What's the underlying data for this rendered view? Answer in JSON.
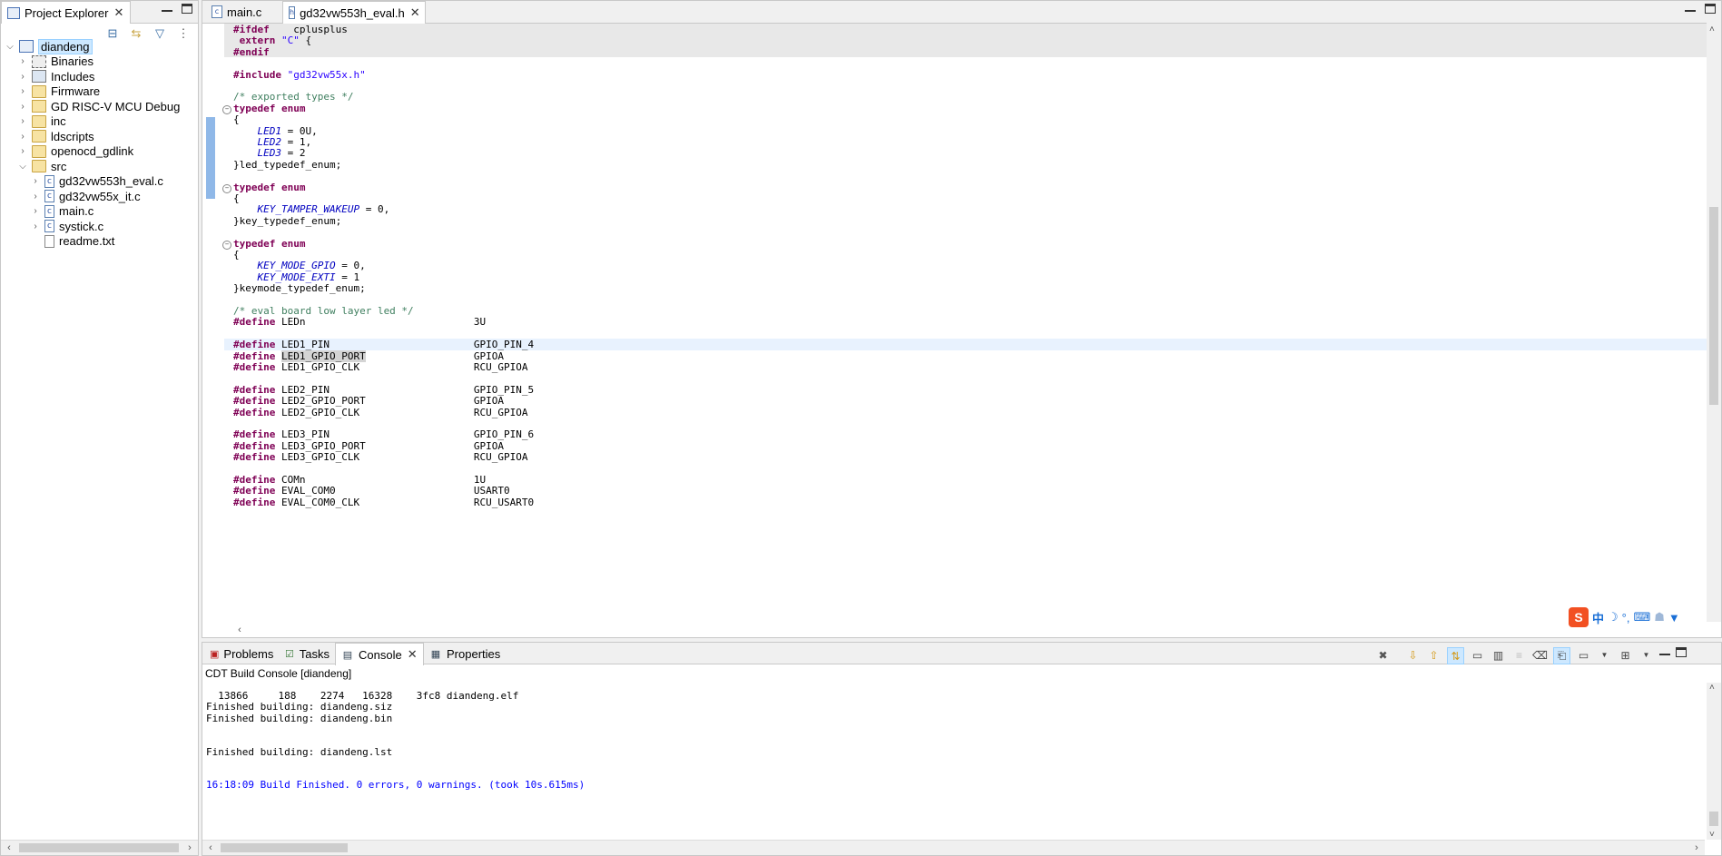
{
  "project_explorer": {
    "tab_label": "Project Explorer",
    "tree": [
      {
        "label": "diandeng",
        "type": "project",
        "expanded": true,
        "depth": 0,
        "selected": true
      },
      {
        "label": "Binaries",
        "type": "binaries",
        "depth": 1
      },
      {
        "label": "Includes",
        "type": "includes",
        "depth": 1
      },
      {
        "label": "Firmware",
        "type": "folder",
        "depth": 1
      },
      {
        "label": "GD RISC-V MCU Debug",
        "type": "debug",
        "depth": 1
      },
      {
        "label": "inc",
        "type": "folder",
        "depth": 1
      },
      {
        "label": "ldscripts",
        "type": "folder",
        "depth": 1
      },
      {
        "label": "openocd_gdlink",
        "type": "folder",
        "depth": 1
      },
      {
        "label": "src",
        "type": "folder",
        "expanded": true,
        "depth": 1
      },
      {
        "label": "gd32vw553h_eval.c",
        "type": "cfile",
        "depth": 2
      },
      {
        "label": "gd32vw55x_it.c",
        "type": "cfile",
        "depth": 2
      },
      {
        "label": "main.c",
        "type": "cfile",
        "depth": 2
      },
      {
        "label": "systick.c",
        "type": "cfile",
        "depth": 2
      },
      {
        "label": "readme.txt",
        "type": "txt",
        "depth": 2,
        "no_arrow": true
      }
    ]
  },
  "editor": {
    "tabs": [
      {
        "label": "main.c",
        "active": false
      },
      {
        "label": "gd32vw553h_eval.h",
        "active": true
      }
    ],
    "code_lines": [
      {
        "segs": [
          [
            "pp",
            "#ifdef"
          ],
          [
            "",
            "  __cplusplus"
          ]
        ],
        "shade": true
      },
      {
        "segs": [
          [
            "kw",
            " extern"
          ],
          [
            "",
            " "
          ],
          [
            "str",
            "\"C\""
          ],
          [
            "",
            " {"
          ]
        ],
        "shade": true
      },
      {
        "segs": [
          [
            "pp",
            "#endif"
          ]
        ],
        "shade": true
      },
      {
        "segs": []
      },
      {
        "segs": [
          [
            "pp",
            "#include"
          ],
          [
            "",
            " "
          ],
          [
            "str",
            "\"gd32vw55x.h\""
          ]
        ]
      },
      {
        "segs": []
      },
      {
        "segs": [
          [
            "cm",
            "/* exported types */"
          ]
        ]
      },
      {
        "segs": [
          [
            "kw",
            "typedef"
          ],
          [
            "",
            " "
          ],
          [
            "kw",
            "enum"
          ]
        ],
        "fold": true
      },
      {
        "segs": [
          [
            "",
            "{"
          ]
        ]
      },
      {
        "segs": [
          [
            "",
            "    "
          ],
          [
            "en",
            "LED1"
          ],
          [
            "",
            " = 0U,"
          ]
        ]
      },
      {
        "segs": [
          [
            "",
            "    "
          ],
          [
            "en",
            "LED2"
          ],
          [
            "",
            " = 1,"
          ]
        ]
      },
      {
        "segs": [
          [
            "",
            "    "
          ],
          [
            "en",
            "LED3"
          ],
          [
            "",
            " = 2"
          ]
        ]
      },
      {
        "segs": [
          [
            "",
            "}led_typedef_enum;"
          ]
        ]
      },
      {
        "segs": []
      },
      {
        "segs": [
          [
            "kw",
            "typedef"
          ],
          [
            "",
            " "
          ],
          [
            "kw",
            "enum"
          ]
        ],
        "fold": true
      },
      {
        "segs": [
          [
            "",
            "{"
          ]
        ]
      },
      {
        "segs": [
          [
            "",
            "    "
          ],
          [
            "en",
            "KEY_TAMPER_WAKEUP"
          ],
          [
            "",
            " = 0,"
          ]
        ]
      },
      {
        "segs": [
          [
            "",
            "}key_typedef_enum;"
          ]
        ]
      },
      {
        "segs": []
      },
      {
        "segs": [
          [
            "kw",
            "typedef"
          ],
          [
            "",
            " "
          ],
          [
            "kw",
            "enum"
          ]
        ],
        "fold": true
      },
      {
        "segs": [
          [
            "",
            "{"
          ]
        ]
      },
      {
        "segs": [
          [
            "",
            "    "
          ],
          [
            "en",
            "KEY_MODE_GPIO"
          ],
          [
            "",
            " = 0,"
          ]
        ]
      },
      {
        "segs": [
          [
            "",
            "    "
          ],
          [
            "en",
            "KEY_MODE_EXTI"
          ],
          [
            "",
            " = 1"
          ]
        ]
      },
      {
        "segs": [
          [
            "",
            "}keymode_typedef_enum;"
          ]
        ]
      },
      {
        "segs": []
      },
      {
        "segs": [
          [
            "cm",
            "/* eval board low layer led */"
          ]
        ]
      },
      {
        "segs": [
          [
            "pp",
            "#define"
          ],
          [
            "",
            " LEDn                            3U"
          ]
        ]
      },
      {
        "segs": []
      },
      {
        "segs": [
          [
            "pp",
            "#define"
          ],
          [
            "",
            " LED1_PIN                        GPIO_PIN_4"
          ]
        ],
        "current": true
      },
      {
        "segs": [
          [
            "pp",
            "#define"
          ],
          [
            "",
            " "
          ],
          [
            "sel",
            "LED1_GPIO_PORT"
          ],
          [
            "",
            "                  GPIOA"
          ]
        ]
      },
      {
        "segs": [
          [
            "pp",
            "#define"
          ],
          [
            "",
            " LED1_GPIO_CLK                   RCU_GPIOA"
          ]
        ]
      },
      {
        "segs": []
      },
      {
        "segs": [
          [
            "pp",
            "#define"
          ],
          [
            "",
            " LED2_PIN                        GPIO_PIN_5"
          ]
        ]
      },
      {
        "segs": [
          [
            "pp",
            "#define"
          ],
          [
            "",
            " LED2_GPIO_PORT                  GPIOA"
          ]
        ]
      },
      {
        "segs": [
          [
            "pp",
            "#define"
          ],
          [
            "",
            " LED2_GPIO_CLK                   RCU_GPIOA"
          ]
        ]
      },
      {
        "segs": []
      },
      {
        "segs": [
          [
            "pp",
            "#define"
          ],
          [
            "",
            " LED3_PIN                        GPIO_PIN_6"
          ]
        ]
      },
      {
        "segs": [
          [
            "pp",
            "#define"
          ],
          [
            "",
            " LED3_GPIO_PORT                  GPIOA"
          ]
        ]
      },
      {
        "segs": [
          [
            "pp",
            "#define"
          ],
          [
            "",
            " LED3_GPIO_CLK                   RCU_GPIOA"
          ]
        ]
      },
      {
        "segs": []
      },
      {
        "segs": [
          [
            "pp",
            "#define"
          ],
          [
            "",
            " COMn                            1U"
          ]
        ]
      },
      {
        "segs": [
          [
            "pp",
            "#define"
          ],
          [
            "",
            " EVAL_COM0                       USART0"
          ]
        ]
      },
      {
        "segs": [
          [
            "pp",
            "#define"
          ],
          [
            "",
            " EVAL_COM0_CLK                   RCU_USART0"
          ]
        ]
      }
    ]
  },
  "console": {
    "tabs": [
      {
        "label": "Problems",
        "active": false
      },
      {
        "label": "Tasks",
        "active": false
      },
      {
        "label": "Console",
        "active": true
      },
      {
        "label": "Properties",
        "active": false
      }
    ],
    "title": "CDT Build Console [diandeng]",
    "lines": [
      {
        "text": "  13866     188    2274   16328    3fc8 diandeng.elf",
        "color": "#000000"
      },
      {
        "text": "Finished building: diandeng.siz",
        "color": "#000000"
      },
      {
        "text": "Finished building: diandeng.bin",
        "color": "#000000"
      },
      {
        "text": "",
        "color": "#000000"
      },
      {
        "text": "",
        "color": "#000000"
      },
      {
        "text": "Finished building: diandeng.lst",
        "color": "#000000"
      },
      {
        "text": "",
        "color": "#000000"
      },
      {
        "text": "",
        "color": "#000000"
      },
      {
        "text": "16:18:09 Build Finished. 0 errors, 0 warnings. (took 10s.615ms)",
        "color": "#0000ff"
      }
    ]
  },
  "ime": {
    "label": "中"
  },
  "colors": {
    "accent": "#3daee9",
    "shade_line": "#e8e8e8",
    "current_line": "#e8f2fe",
    "selection": "#d4d4d4"
  }
}
